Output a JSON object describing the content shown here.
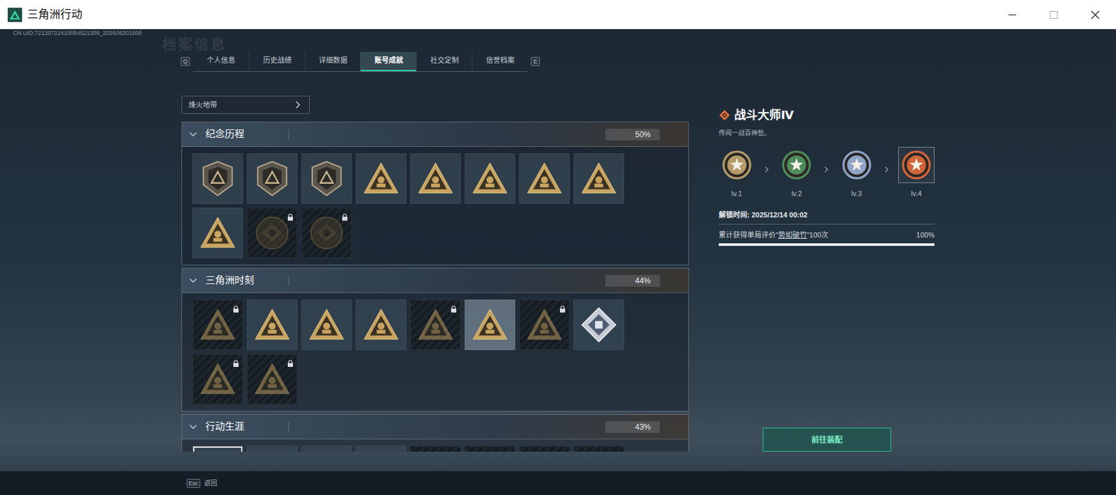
{
  "window": {
    "title": "三角洲行动"
  },
  "uid": "CN.UID:72120722410054521309_202608201500",
  "watermark": "档案信息",
  "tabs": {
    "prev_key": "Q",
    "next_key": "E",
    "items": [
      {
        "label": "个人信息",
        "selected": false
      },
      {
        "label": "历史战绩",
        "selected": false
      },
      {
        "label": "详细数据",
        "selected": false
      },
      {
        "label": "账号成就",
        "selected": true
      },
      {
        "label": "社交定制",
        "selected": false
      },
      {
        "label": "信誉档案",
        "selected": false
      }
    ]
  },
  "mode_select": {
    "value": "烽火地带",
    "expanded": false
  },
  "sections": [
    {
      "title": "纪念历程",
      "percent": "50%",
      "expanded": true,
      "badges": [
        {
          "kind": "shield",
          "locked": false,
          "selected": false,
          "focused": false
        },
        {
          "kind": "shield",
          "locked": false,
          "selected": false,
          "focused": false
        },
        {
          "kind": "shield",
          "locked": false,
          "selected": false,
          "focused": false
        },
        {
          "kind": "triangle",
          "locked": false,
          "selected": false,
          "focused": false
        },
        {
          "kind": "triangle",
          "locked": false,
          "selected": false,
          "focused": false
        },
        {
          "kind": "triangle",
          "locked": false,
          "selected": false,
          "focused": false
        },
        {
          "kind": "triangle",
          "locked": false,
          "selected": false,
          "focused": false
        },
        {
          "kind": "triangle",
          "locked": false,
          "selected": false,
          "focused": false
        },
        {
          "kind": "triangle",
          "locked": false,
          "selected": false,
          "focused": false
        },
        {
          "kind": "round",
          "locked": true,
          "selected": false,
          "focused": false
        },
        {
          "kind": "round",
          "locked": true,
          "selected": false,
          "focused": false
        }
      ]
    },
    {
      "title": "三角洲时刻",
      "percent": "44%",
      "expanded": true,
      "badges": [
        {
          "kind": "triangle",
          "locked": true,
          "selected": false,
          "focused": false
        },
        {
          "kind": "triangle",
          "locked": false,
          "selected": false,
          "focused": false
        },
        {
          "kind": "triangle",
          "locked": false,
          "selected": false,
          "focused": false
        },
        {
          "kind": "triangle",
          "locked": false,
          "selected": false,
          "focused": false
        },
        {
          "kind": "triangle",
          "locked": true,
          "selected": false,
          "focused": false
        },
        {
          "kind": "triangle",
          "locked": false,
          "selected": true,
          "focused": false
        },
        {
          "kind": "triangle",
          "locked": true,
          "selected": false,
          "focused": false
        },
        {
          "kind": "diamond",
          "locked": false,
          "selected": false,
          "focused": false
        },
        {
          "kind": "triangle",
          "locked": true,
          "selected": false,
          "focused": false
        },
        {
          "kind": "triangle",
          "locked": true,
          "selected": false,
          "focused": false
        }
      ]
    },
    {
      "title": "行动生涯",
      "percent": "43%",
      "expanded": true,
      "badges": [
        {
          "kind": "triangle",
          "locked": false,
          "selected": false,
          "focused": true
        },
        {
          "kind": "triangle",
          "locked": false,
          "selected": false,
          "focused": false
        },
        {
          "kind": "triangle",
          "locked": false,
          "selected": false,
          "focused": false
        },
        {
          "kind": "triangle",
          "locked": false,
          "selected": false,
          "focused": false
        },
        {
          "kind": "triangle",
          "locked": true,
          "selected": false,
          "focused": false
        },
        {
          "kind": "triangle",
          "locked": true,
          "selected": false,
          "focused": false
        },
        {
          "kind": "triangle",
          "locked": true,
          "selected": false,
          "focused": false
        },
        {
          "kind": "triangle",
          "locked": true,
          "selected": false,
          "focused": false
        }
      ]
    }
  ],
  "detail": {
    "title": "战斗大师Ⅳ",
    "description": "传闻一战百神愁。",
    "levels": [
      {
        "label": "lv.1",
        "color": "#b59a6a",
        "selected": false
      },
      {
        "label": "lv.2",
        "color": "#4f8a5a",
        "selected": false
      },
      {
        "label": "lv.3",
        "color": "#8fa4c8",
        "selected": false
      },
      {
        "label": "lv.4",
        "color": "#d0643a",
        "selected": true
      }
    ],
    "unlock_time": "解锁时间: 2025/12/14 00:02",
    "requirement": {
      "prefix": "累计获得单局评价\"",
      "highlight": "势如破竹",
      "suffix": "\"100次",
      "reading": "100%",
      "level": 1
    }
  },
  "equip_button": "前往装配",
  "footer": {
    "key": "Esc",
    "label": "返回"
  }
}
